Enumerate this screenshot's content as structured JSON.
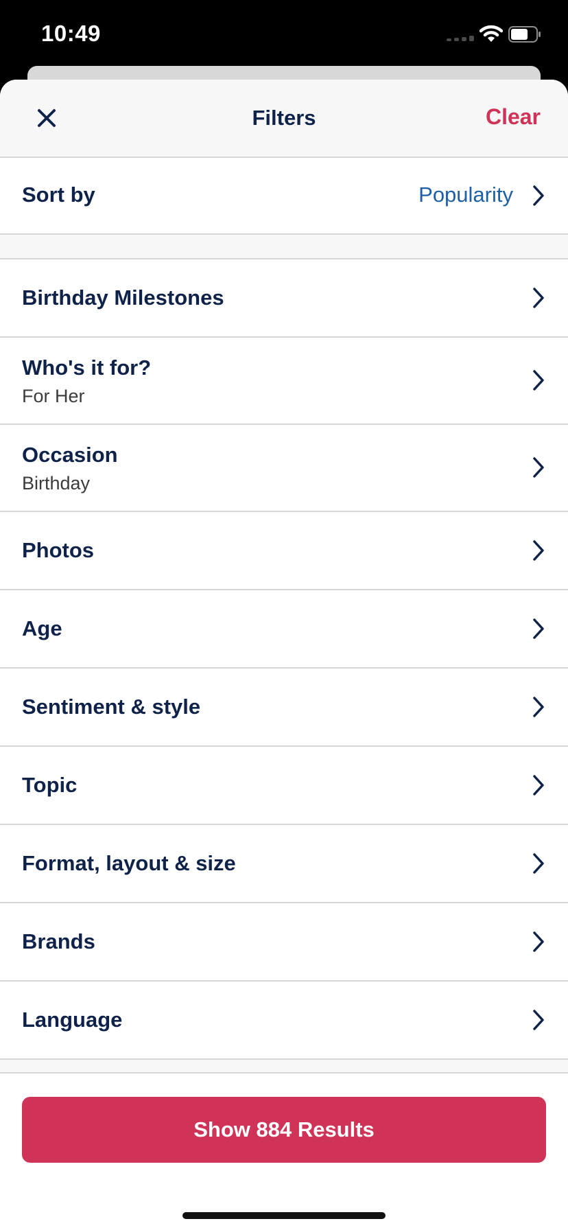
{
  "status_bar": {
    "time": "10:49"
  },
  "header": {
    "title": "Filters",
    "clear_label": "Clear",
    "close_icon": "close-icon"
  },
  "sort": {
    "label": "Sort by",
    "value": "Popularity"
  },
  "filters": [
    {
      "label": "Birthday Milestones",
      "sub": ""
    },
    {
      "label": "Who's it for?",
      "sub": "For Her"
    },
    {
      "label": "Occasion",
      "sub": "Birthday"
    },
    {
      "label": "Photos",
      "sub": ""
    },
    {
      "label": "Age",
      "sub": ""
    },
    {
      "label": "Sentiment & style",
      "sub": ""
    },
    {
      "label": "Topic",
      "sub": ""
    },
    {
      "label": "Format, layout & size",
      "sub": ""
    },
    {
      "label": "Brands",
      "sub": ""
    },
    {
      "label": "Language",
      "sub": ""
    }
  ],
  "footer": {
    "show_results_label": "Show 884 Results"
  },
  "colors": {
    "navy": "#0f2249",
    "accent": "#cf3357",
    "link": "#1e5fa6"
  }
}
